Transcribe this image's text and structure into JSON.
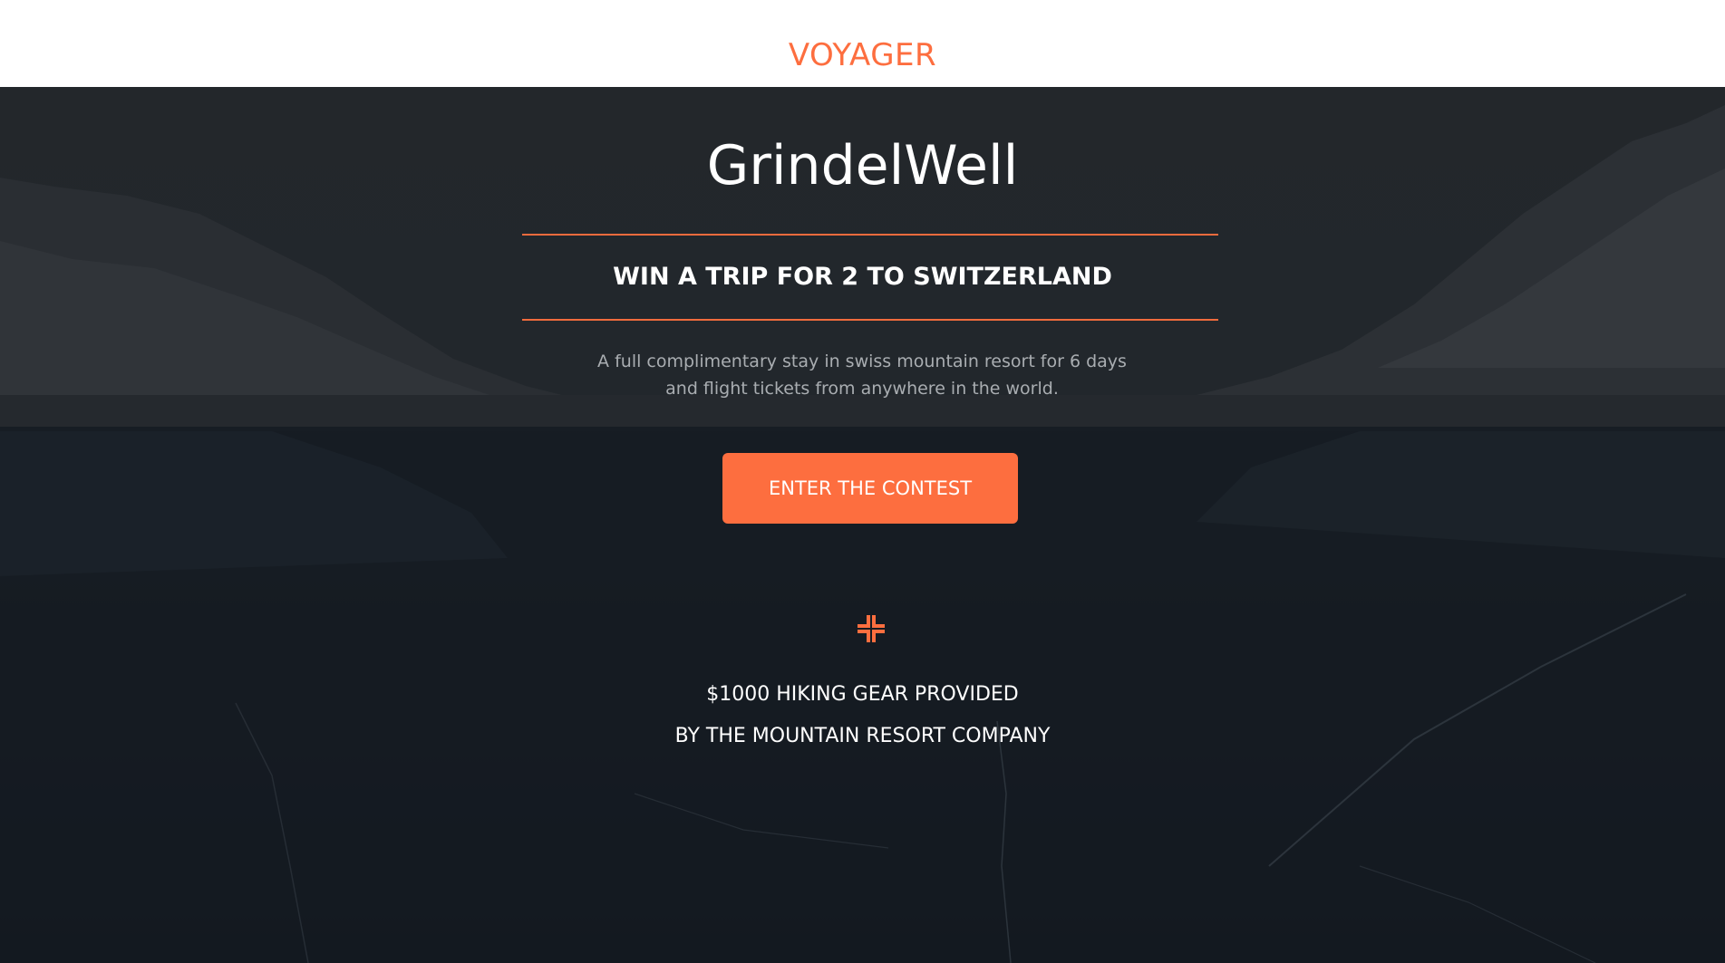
{
  "header": {
    "brand": "VOYAGER"
  },
  "hero": {
    "title": "GrindelWell",
    "subtitle": "WIN A TRIP FOR 2 TO SWITZERLAND",
    "description": "A full complimentary stay in swiss mountain resort for 6 days and flight tickets from anywhere in the world.",
    "cta_label": "ENTER THE CONTEST",
    "perk_icon": "compress-arrows-icon",
    "perk_line_1": "$1000 HIKING GEAR PROVIDED",
    "perk_line_2": "BY THE MOUNTAIN RESORT COMPANY"
  },
  "colors": {
    "accent": "#fd6e3f",
    "hero_overlay": "#22272c",
    "description_text": "#a9adb1",
    "header_bg": "#ffffff"
  }
}
